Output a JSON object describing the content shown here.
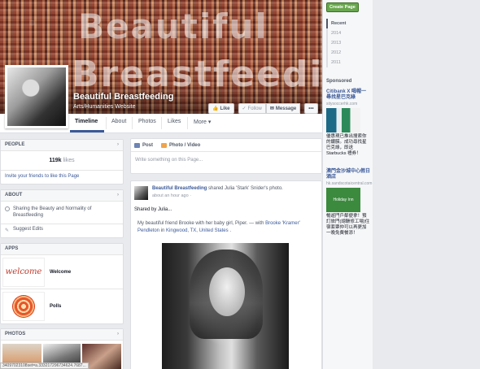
{
  "cover": {
    "word_top": "Beautiful",
    "word_bottom": "Breastfeeding"
  },
  "page": {
    "title": "Beautiful Breastfeeding",
    "category": "Arts/Humanities Website"
  },
  "cover_buttons": {
    "like": "Like",
    "follow": "Follow",
    "message": "Message",
    "more": "•••"
  },
  "tabs": [
    {
      "label": "Timeline"
    },
    {
      "label": "About"
    },
    {
      "label": "Photos"
    },
    {
      "label": "Likes"
    },
    {
      "label": "More"
    }
  ],
  "people": {
    "header": "PEOPLE",
    "count": "119k",
    "count_label": "likes",
    "invite": "Invite your friends to like this Page"
  },
  "about": {
    "header": "ABOUT",
    "text": "Sharing the Beauty and Normality of Breastfeeding",
    "suggest": "Suggest Edits"
  },
  "apps": {
    "header": "APPS",
    "items": [
      {
        "thumb": "welcome",
        "name": "Welcome"
      },
      {
        "name": "Polls"
      }
    ]
  },
  "photos": {
    "header": "PHOTOS"
  },
  "status_url": "34097023108set=a.333217296734624.7687...",
  "composer": {
    "post": "Post",
    "photo_video": "Photo / Video",
    "placeholder": "Write something on this Page..."
  },
  "post": {
    "author": "Beautiful Breastfeeding",
    "action": "shared Julia 'Stark' Snider's photo.",
    "time": "about an hour ago",
    "text": "Shared by Julia...",
    "shared_prefix": "My beautiful friend Brooke with her baby girl, Piper. — with ",
    "tagged": "Brooke 'Kramer' Pendleton",
    "in_word": " in ",
    "location": "Kingwood, TX, United States",
    "end": "."
  },
  "sidebar": {
    "create_page": "Create Page",
    "years": [
      "Recent",
      "2014",
      "2013",
      "2012",
      "2011"
    ],
    "sponsored": "Sponsored",
    "ads": [
      {
        "title": "Citibank X 喝帽一尋找星巴克綠",
        "url": "sitysoccerhk.com",
        "body": "優惠現已推出搜索你的鍍膜。成功尋找星巴克綠，即送Starbucks 禮券！"
      },
      {
        "title": "澳門金沙城中心假日酒店",
        "url": "hk.sandscotaicentral.com",
        "img_label": "Holiday Inn",
        "body": "暢遊門戶鄰便拿！預訂旅門(總酬修工場)住宿套票仲可以再更加一晚免費餐添！"
      }
    ]
  },
  "colors": {
    "fb_blue": "#3b5998",
    "create_green": "#69a74e",
    "page_bg": "#e9eaed"
  }
}
